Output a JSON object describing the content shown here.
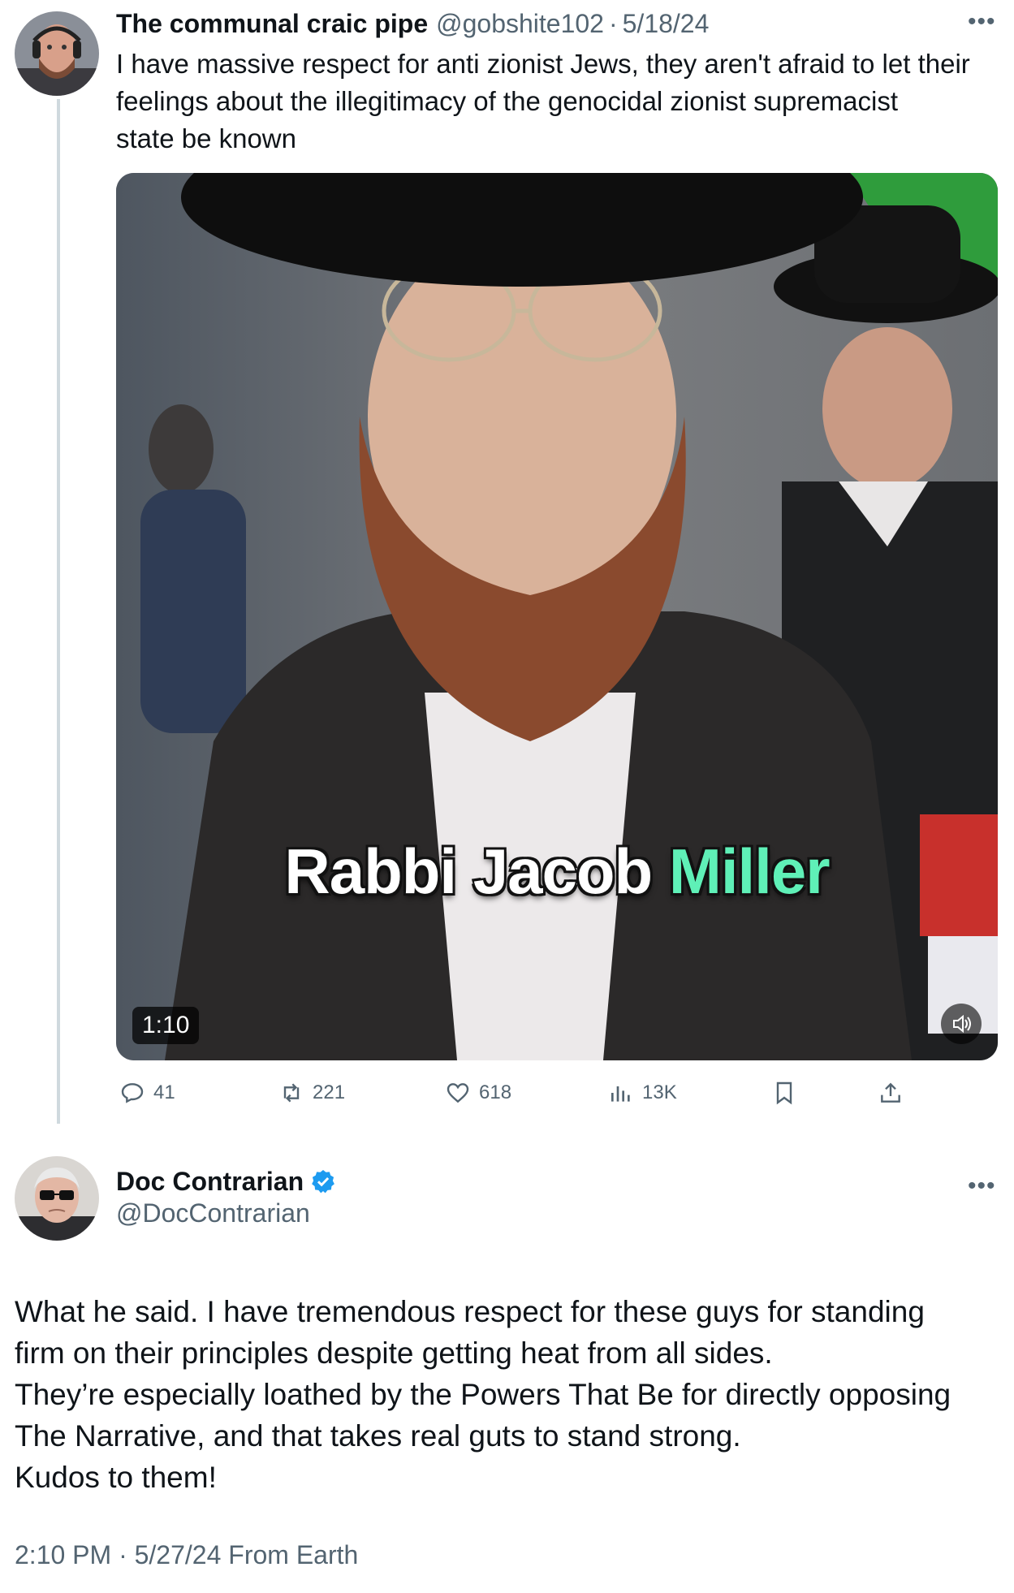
{
  "tweet1": {
    "author_name": "The communal craic pipe",
    "author_handle": "@gobshite102",
    "separator": "·",
    "date": "5/18/24",
    "text_lines": [
      "I have massive respect for anti zionist Jews, they aren't afraid to let their",
      "feelings about the illegitimacy of the genocidal zionist supremacist",
      "state be known"
    ],
    "video": {
      "caption_part1": "Rabbi Jacob ",
      "caption_part2": "Miller",
      "duration": "1:10"
    },
    "stats": {
      "replies": "41",
      "reposts": "221",
      "likes": "618",
      "views": "13K"
    }
  },
  "tweet2": {
    "author_name": "Doc Contrarian",
    "author_handle": "@DocContrarian",
    "text_lines": [
      "What he said. I have tremendous respect for these guys for standing",
      "firm on their principles despite getting heat from all sides.",
      "They’re especially loathed by the Powers That Be for directly opposing",
      "The Narrative, and that takes real guts to stand strong.",
      "Kudos to them!"
    ],
    "timestamp": "2:10 PM · 5/27/24 From Earth"
  },
  "icons": {
    "more": "more-icon",
    "reply": "reply-icon",
    "repost": "repost-icon",
    "like": "heart-icon",
    "views": "views-icon",
    "bookmark": "bookmark-icon",
    "share": "share-icon",
    "verified": "verified-badge-icon",
    "volume": "volume-icon"
  },
  "colors": {
    "text": "#0f1419",
    "secondary": "#536471",
    "verified": "#1d9bf0",
    "caption_accent": "#5ff0b7"
  }
}
